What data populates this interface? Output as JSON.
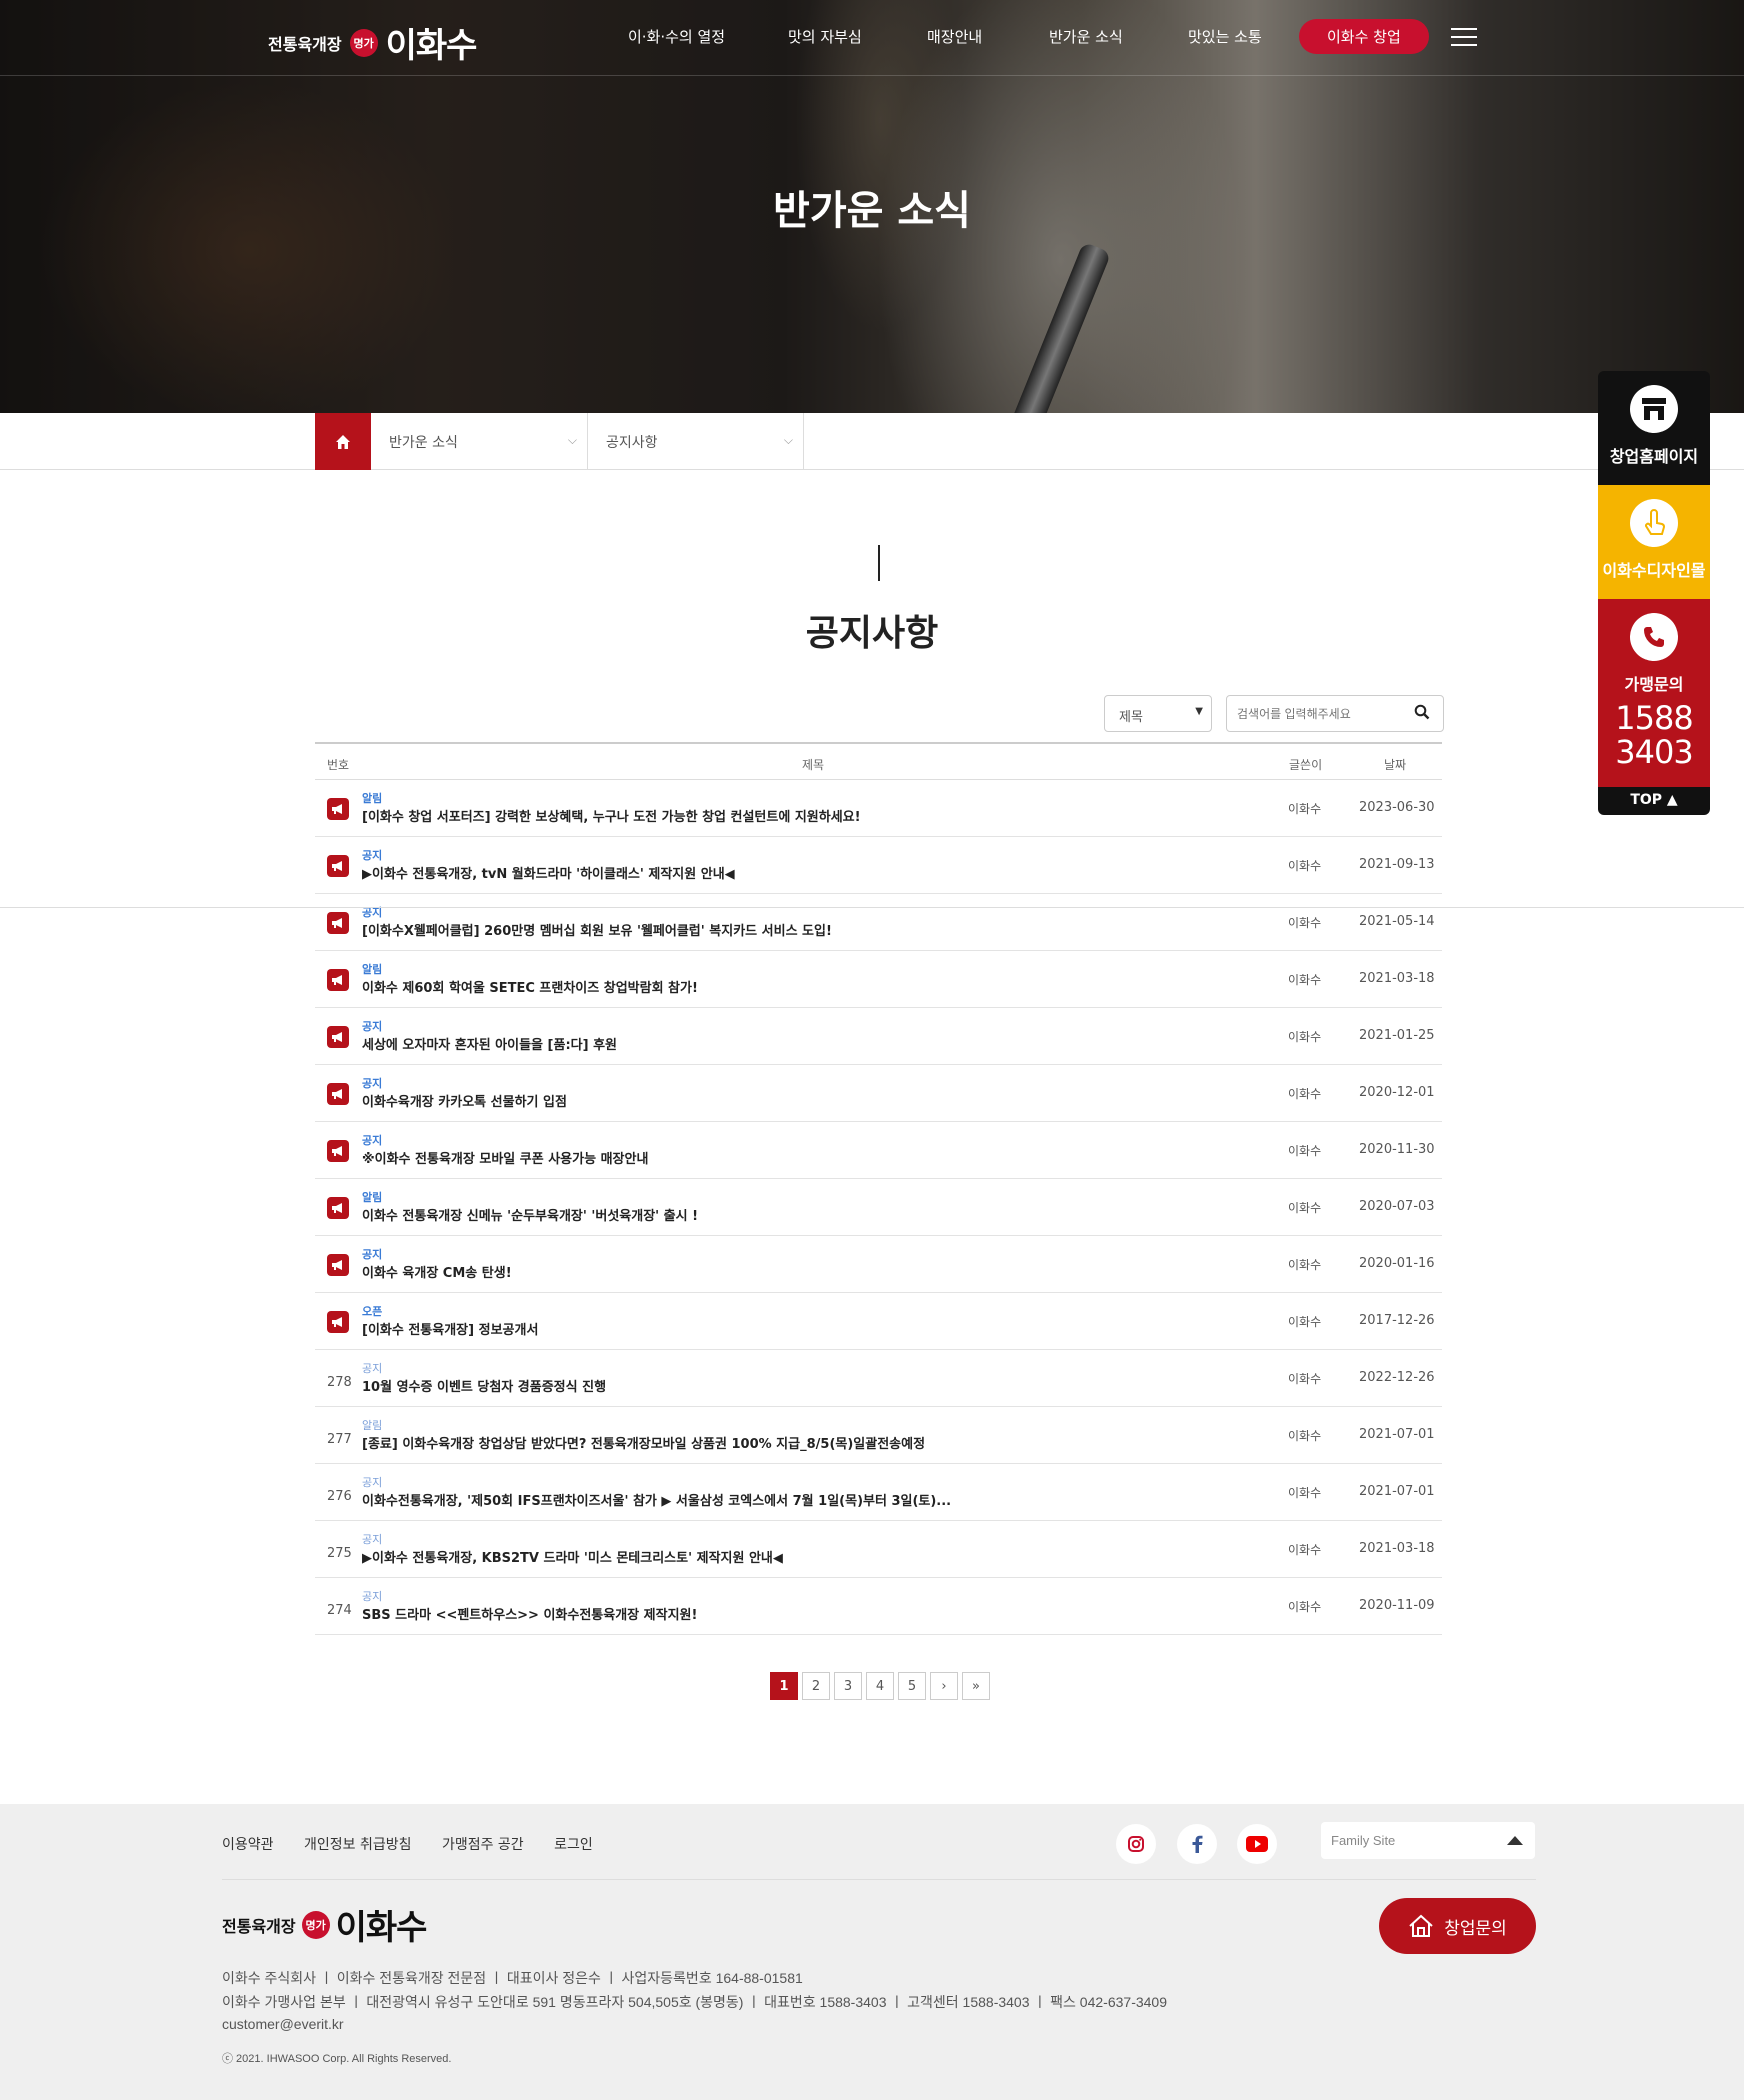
{
  "header": {
    "logo_small": "전통육개장",
    "logo_seal": "명가",
    "logo_big": "이화수",
    "nav": [
      "이·화·수의 열정",
      "맛의 자부심",
      "매장안내",
      "반가운 소식",
      "맛있는 소통"
    ],
    "cta": "이화수 창업"
  },
  "hero": {
    "title": "반가운 소식"
  },
  "subnav": {
    "first": "반가운 소식",
    "second": "공지사항"
  },
  "page": {
    "title": "공지사항"
  },
  "search": {
    "select_value": "제목",
    "placeholder": "검색어를 입력해주세요"
  },
  "table": {
    "headers": {
      "num": "번호",
      "title": "제목",
      "author": "글쓴이",
      "date": "날짜"
    },
    "rows": [
      {
        "num": "",
        "notice": true,
        "cat": "알림",
        "title": "[이화수 창업 서포터즈] 강력한 보상혜택, 누구나 도전 가능한 창업 컨설턴트에 지원하세요!",
        "author": "이화수",
        "date": "2023-06-30"
      },
      {
        "num": "",
        "notice": true,
        "cat": "공지",
        "title": "▶이화수 전통육개장, tvN 월화드라마 '하이클래스' 제작지원 안내◀",
        "author": "이화수",
        "date": "2021-09-13"
      },
      {
        "num": "",
        "notice": true,
        "cat": "공지",
        "title": "[이화수X웰페어클럽] 260만명 멤버십 회원 보유 '웰페어클럽' 복지카드 서비스 도입!",
        "author": "이화수",
        "date": "2021-05-14"
      },
      {
        "num": "",
        "notice": true,
        "cat": "알림",
        "title": "이화수 제60회 학여울 SETEC 프랜차이즈 창업박람회 참가!",
        "author": "이화수",
        "date": "2021-03-18"
      },
      {
        "num": "",
        "notice": true,
        "cat": "공지",
        "title": "세상에 오자마자 혼자된 아이들을 [품:다] 후원",
        "author": "이화수",
        "date": "2021-01-25"
      },
      {
        "num": "",
        "notice": true,
        "cat": "공지",
        "title": "이화수육개장 카카오톡 선물하기 입점",
        "author": "이화수",
        "date": "2020-12-01"
      },
      {
        "num": "",
        "notice": true,
        "cat": "공지",
        "title": "※이화수 전통육개장 모바일 쿠폰 사용가능 매장안내",
        "author": "이화수",
        "date": "2020-11-30"
      },
      {
        "num": "",
        "notice": true,
        "cat": "알림",
        "title": "이화수 전통육개장 신메뉴 '순두부육개장' '버섯육개장' 출시 !",
        "author": "이화수",
        "date": "2020-07-03"
      },
      {
        "num": "",
        "notice": true,
        "cat": "공지",
        "title": "이화수 육개장 CM송 탄생!",
        "author": "이화수",
        "date": "2020-01-16"
      },
      {
        "num": "",
        "notice": true,
        "cat": "오픈",
        "title": "[이화수 전통육개장] 정보공개서",
        "author": "이화수",
        "date": "2017-12-26"
      },
      {
        "num": "278",
        "notice": false,
        "cat": "공지",
        "title": "10월 영수증 이벤트 당첨자 경품증정식 진행",
        "author": "이화수",
        "date": "2022-12-26"
      },
      {
        "num": "277",
        "notice": false,
        "cat": "알림",
        "title": "[종료] 이화수육개장 창업상담 받았다면? 전통육개장모바일 상품권 100% 지급_8/5(목)일괄전송예정",
        "author": "이화수",
        "date": "2021-07-01"
      },
      {
        "num": "276",
        "notice": false,
        "cat": "공지",
        "title": "이화수전통육개장, '제50회 IFS프랜차이즈서울' 참가 ▶ 서울삼성 코엑스에서 7월 1일(목)부터 3일(토)...",
        "author": "이화수",
        "date": "2021-07-01"
      },
      {
        "num": "275",
        "notice": false,
        "cat": "공지",
        "title": "▶이화수 전통육개장, KBS2TV 드라마 '미스 몬테크리스토' 제작지원 안내◀",
        "author": "이화수",
        "date": "2021-03-18"
      },
      {
        "num": "274",
        "notice": false,
        "cat": "공지",
        "title": "SBS 드라마 <<펜트하우스>> 이화수전통육개장 제작지원!",
        "author": "이화수",
        "date": "2020-11-09"
      }
    ]
  },
  "pagination": [
    "1",
    "2",
    "3",
    "4",
    "5",
    "›",
    "»"
  ],
  "floating": {
    "btn1": "창업홈페이지",
    "btn2": "이화수디자인몰",
    "btn3_label": "가맹문의",
    "btn3_phone_1": "1588",
    "btn3_phone_2": "3403",
    "top": "TOP ▲"
  },
  "footer": {
    "links": [
      "이용약관",
      "개인정보 취급방침",
      "가맹점주 공간",
      "로그인"
    ],
    "family_site": "Family Site",
    "cta": "창업문의",
    "info1": "이화수 주식회사 ㅣ 이화수 전통육개장 전문점 ㅣ 대표이사 정은수 ㅣ 사업자등록번호 164-88-01581",
    "info2": "이화수 가맹사업 본부 ㅣ 대전광역시 유성구 도안대로 591 명동프라자 504,505호 (봉명동) ㅣ 대표번호 1588-3403 ㅣ 고객센터 1588-3403 ㅣ 팩스 042-637-3409",
    "info3": "customer@everit.kr",
    "copyright": "ⓒ 2021. IHWASOO Corp. All Rights Reserved."
  },
  "colors": {
    "brand_red": "#b5121b",
    "yellow": "#f5b400",
    "category_blue": "#3a7bd5"
  }
}
